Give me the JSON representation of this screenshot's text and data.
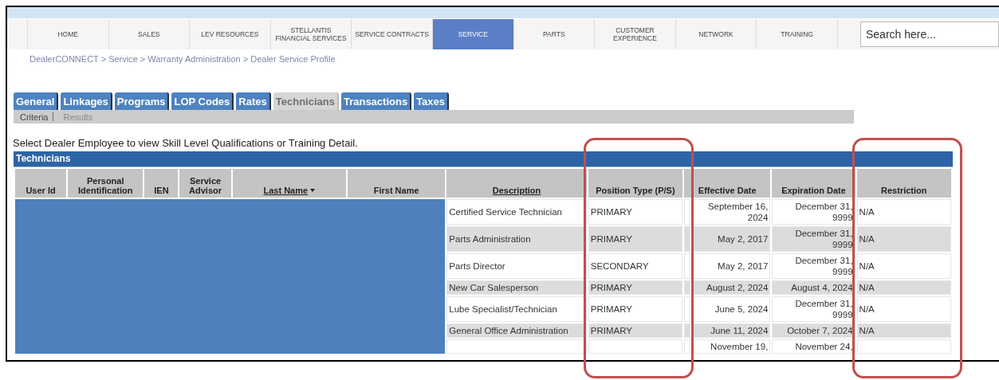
{
  "nav": {
    "items": [
      {
        "label": "HOME",
        "selected": false
      },
      {
        "label": "SALES",
        "selected": false
      },
      {
        "label": "LEV RESOURCES",
        "selected": false
      },
      {
        "label": "STELLANTIS FINANCIAL SERVICES",
        "selected": false
      },
      {
        "label": "SERVICE CONTRACTS",
        "selected": false
      },
      {
        "label": "SERVICE",
        "selected": true
      },
      {
        "label": "PARTS",
        "selected": false
      },
      {
        "label": "CUSTOMER EXPERIENCE",
        "selected": false
      },
      {
        "label": "NETWORK",
        "selected": false
      },
      {
        "label": "TRAINING",
        "selected": false
      }
    ],
    "search": {
      "placeholder": "Search here..."
    }
  },
  "breadcrumb": "DealerCONNECT > Service > Warranty Administration > Dealer Service Profile",
  "tabs": [
    {
      "label": "General",
      "selected": false
    },
    {
      "label": "Linkages",
      "selected": false
    },
    {
      "label": "Programs",
      "selected": false
    },
    {
      "label": "LOP Codes",
      "selected": false
    },
    {
      "label": "Rates",
      "selected": false
    },
    {
      "label": "Technicians",
      "selected": true
    },
    {
      "label": "Transactions",
      "selected": false
    },
    {
      "label": "Taxes",
      "selected": false
    }
  ],
  "subtabs": [
    "Criteria",
    "Results"
  ],
  "instruction": "Select Dealer Employee to view Skill Level Qualifications or Training Detail.",
  "table": {
    "title": "Technicians",
    "redacted": true,
    "columns": [
      {
        "label": "User Id",
        "sortable": false,
        "sorted": false,
        "highlighted": false
      },
      {
        "label": "Personal Identification",
        "sortable": false,
        "sorted": false,
        "highlighted": false
      },
      {
        "label": "IEN",
        "sortable": false,
        "sorted": false,
        "highlighted": false
      },
      {
        "label": "Service Advisor",
        "sortable": false,
        "sorted": false,
        "highlighted": false
      },
      {
        "label": "Last Name",
        "sortable": true,
        "sorted": true,
        "highlighted": false
      },
      {
        "label": "First Name",
        "sortable": false,
        "sorted": false,
        "highlighted": false
      },
      {
        "label": "Description",
        "sortable": true,
        "sorted": false,
        "highlighted": false
      },
      {
        "label": "Position Type (P/S)",
        "sortable": false,
        "sorted": false,
        "highlighted": true
      },
      {
        "label": "Effective Date",
        "sortable": false,
        "sorted": false,
        "highlighted": false
      },
      {
        "label": "Expiration Date",
        "sortable": false,
        "sorted": false,
        "highlighted": false
      },
      {
        "label": "Restriction",
        "sortable": false,
        "sorted": false,
        "highlighted": true
      }
    ],
    "rows": [
      {
        "description": "Certified Service Technician",
        "position": "PRIMARY",
        "effective": "September 16, 2024",
        "expiration": "December 31, 9999",
        "restriction": "N/A"
      },
      {
        "description": "Parts Administration",
        "position": "PRIMARY",
        "effective": "May 2, 2017",
        "expiration": "December 31, 9999",
        "restriction": "N/A"
      },
      {
        "description": "Parts Director",
        "position": "SECONDARY",
        "effective": "May 2, 2017",
        "expiration": "December 31, 9999",
        "restriction": "N/A"
      },
      {
        "description": "New Car Salesperson",
        "position": "PRIMARY",
        "effective": "August 2, 2024",
        "expiration": "August 4, 2024",
        "restriction": "N/A"
      },
      {
        "description": "Lube Specialist/Technician",
        "position": "PRIMARY",
        "effective": "June 5, 2024",
        "expiration": "December 31, 9999",
        "restriction": "N/A"
      },
      {
        "description": "General Office Administration",
        "position": "PRIMARY",
        "effective": "June 11, 2024",
        "expiration": "October 7, 2024",
        "restriction": "N/A"
      },
      {
        "effective": "November 19,",
        "expiration": "November 24,"
      }
    ]
  }
}
